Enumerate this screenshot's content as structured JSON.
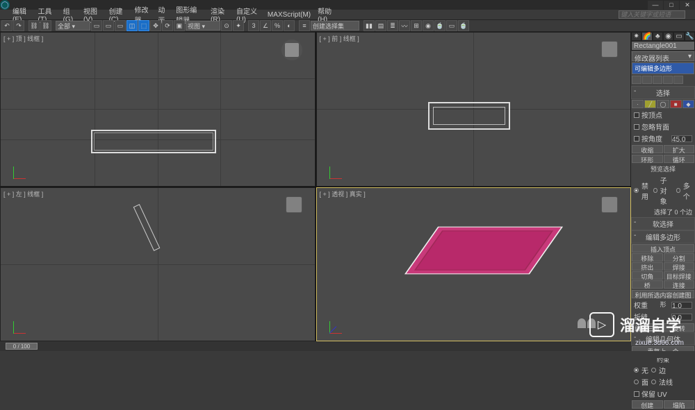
{
  "title": {
    "search_placeholder": "键入关键字或短语"
  },
  "winbtns": {
    "min": "—",
    "max": "□",
    "close": "✕"
  },
  "menu": [
    "编辑(E)",
    "工具(T)",
    "组(G)",
    "视图(V)",
    "创建(C)",
    "修改器",
    "动画",
    "图形编辑器",
    "渲染(R)",
    "自定义(U)",
    "MAXScript(M)",
    "帮助(H)"
  ],
  "viewports": {
    "tl": "[ + ] 顶 ] 线框 ]",
    "tr": "[ + ] 前 ] 线框 ]",
    "bl": "[ + ] 左 ] 线框 ]",
    "br": "[ + ] 透视 ] 真实 ]"
  },
  "cmd": {
    "objname": "Rectangle001",
    "modlist_label": "修改器列表",
    "stack_item": "可编辑多边形",
    "rollouts": {
      "selection": "选择",
      "softsel": "软选择",
      "editpoly": "编辑多边形"
    },
    "sel": {
      "byVertex": "按顶点",
      "ignoreBack": "忽略背面",
      "byAngle": "按角度",
      "angle": "45.0",
      "shrink": "收缩",
      "grow": "扩大",
      "ring": "环形",
      "loop": "循环",
      "preview": "预览选择",
      "off": "禁用",
      "sub": "子对象",
      "multi": "多个",
      "count": "选择了 0 个边"
    },
    "edit": {
      "insertV": "插入顶点",
      "remove": "移除",
      "split": "分割",
      "extrude": "挤出",
      "weld": "焊接",
      "chamfer": "切角",
      "target": "目标焊接",
      "bridge": "桥",
      "connect": "连接",
      "create": "利用所选内容创建图形",
      "weight": "权重",
      "wval": "1.0",
      "crease": "折缝",
      "cval": "0.0",
      "editTri": "编辑三角剖分",
      "turn": "旋转"
    },
    "geom": {
      "header": "编辑几何体",
      "repeat": "重复上一个",
      "constrain": "约束",
      "none": "无",
      "edge": "边",
      "face": "面",
      "normal": "法线",
      "preserve": "保留 UV",
      "create2": "创建",
      "collapse": "塌陷"
    }
  },
  "timeline": {
    "slider": "0 / 100"
  },
  "watermark": {
    "text": "溜溜自学",
    "url": "zixue.3d66.com"
  }
}
